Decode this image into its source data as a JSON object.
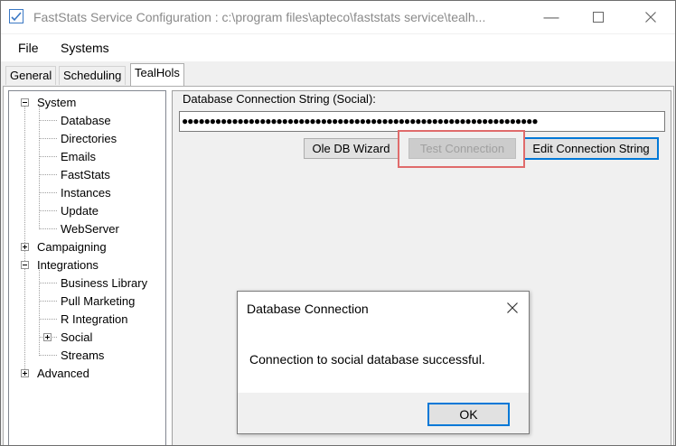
{
  "window": {
    "title": "FastStats Service Configuration : c:\\program files\\apteco\\faststats service\\tealh...",
    "minimize_icon": "minimize-icon",
    "maximize_icon": "maximize-icon",
    "close_icon": "close-icon"
  },
  "menu": {
    "items": [
      "File",
      "Systems"
    ]
  },
  "tabs": [
    {
      "label": "General",
      "active": false
    },
    {
      "label": "Scheduling",
      "active": false
    },
    {
      "label": "TealHols",
      "active": true
    }
  ],
  "tree": {
    "nodes": [
      {
        "label": "System",
        "expander": "minus"
      },
      {
        "label": "Database"
      },
      {
        "label": "Directories"
      },
      {
        "label": "Emails"
      },
      {
        "label": "FastStats"
      },
      {
        "label": "Instances"
      },
      {
        "label": "Update"
      },
      {
        "label": "WebServer"
      },
      {
        "label": "Campaigning",
        "expander": "plus"
      },
      {
        "label": "Integrations",
        "expander": "minus"
      },
      {
        "label": "Business Library"
      },
      {
        "label": "Pull Marketing"
      },
      {
        "label": "R Integration"
      },
      {
        "label": "Social",
        "expander": "plus"
      },
      {
        "label": "Streams"
      },
      {
        "label": "Advanced",
        "expander": "plus"
      }
    ]
  },
  "connection": {
    "label": "Database Connection String (Social):",
    "masked_value": "●●●●●●●●●●●●●●●●●●●●●●●●●●●●●●●●●●●●●●●●●●●●●●●●●●●●●●●●●●●●●●●●",
    "buttons": {
      "ole_db_wizard": "Ole DB Wizard",
      "test_connection": "Test Connection",
      "edit_connection_string": "Edit Connection String"
    }
  },
  "dialog": {
    "title": "Database Connection",
    "message": "Connection to social database successful.",
    "ok_label": "OK",
    "close_icon": "close-icon"
  },
  "colors": {
    "highlight_border": "#e06b6b",
    "focus_border": "#0078d7"
  }
}
